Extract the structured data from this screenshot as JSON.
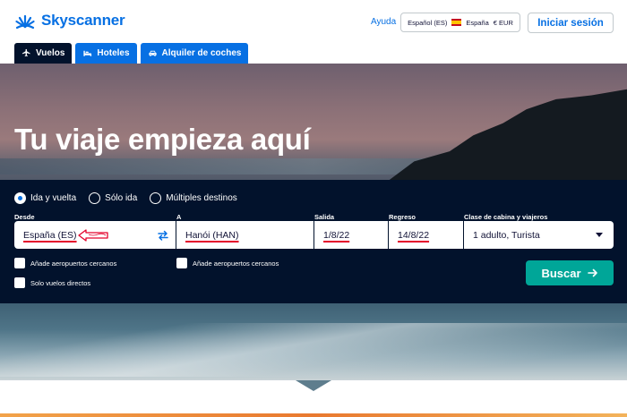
{
  "header": {
    "brand": "Skyscanner",
    "help": "Ayuda",
    "locale": {
      "language": "Español (ES)",
      "country": "España",
      "currency": "€ EUR"
    },
    "login": "Iniciar sesión"
  },
  "tabs": [
    {
      "label": "Vuelos",
      "icon": "plane-icon",
      "active": true
    },
    {
      "label": "Hoteles",
      "icon": "bed-icon",
      "active": false
    },
    {
      "label": "Alquiler de coches",
      "icon": "car-icon",
      "active": false
    }
  ],
  "hero": {
    "title": "Tu viaje empieza aquí"
  },
  "search": {
    "trip_types": [
      {
        "label": "Ida y vuelta",
        "checked": true
      },
      {
        "label": "Sólo ida",
        "checked": false
      },
      {
        "label": "Múltiples destinos",
        "checked": false
      }
    ],
    "from": {
      "label": "Desde",
      "value": "España (ES)"
    },
    "to": {
      "label": "A",
      "value": "Hanói (HAN)"
    },
    "depart": {
      "label": "Salida",
      "value": "1/8/22"
    },
    "return": {
      "label": "Regreso",
      "value": "14/8/22"
    },
    "cabin": {
      "label": "Clase de cabina y viajeros",
      "value": "1 adulto, Turista"
    },
    "nearby_from": "Añade aeropuertos cercanos",
    "nearby_to": "Añade aeropuertos cercanos",
    "direct_only": "Solo vuelos directos",
    "submit": "Buscar"
  },
  "colors": {
    "brand": "#0770e3",
    "panel": "#02122c",
    "cta": "#00a698",
    "annotation": "#e4002b"
  }
}
